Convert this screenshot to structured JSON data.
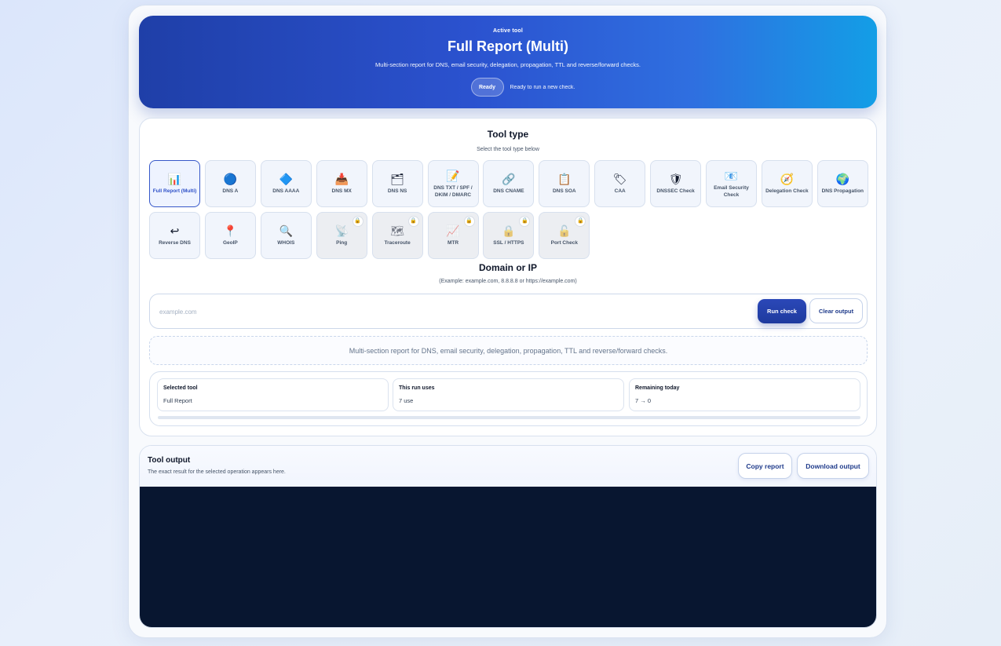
{
  "hero": {
    "kicker": "Active tool",
    "title": "Full Report (Multi)",
    "description": "Multi-section report for DNS, email security, delegation, propagation, TTL and reverse/forward checks.",
    "badge": "Ready",
    "status_text": "Ready to run a new check."
  },
  "tool_type": {
    "title": "Tool type",
    "subtitle": "Select the tool type below",
    "tools": [
      {
        "label": "Full Report (Multi)",
        "icon": "📊",
        "active": true,
        "locked": false
      },
      {
        "label": "DNS A",
        "icon": "🔵",
        "active": false,
        "locked": false
      },
      {
        "label": "DNS AAAA",
        "icon": "🔷",
        "active": false,
        "locked": false
      },
      {
        "label": "DNS MX",
        "icon": "📥",
        "active": false,
        "locked": false
      },
      {
        "label": "DNS NS",
        "icon": "🗂",
        "active": false,
        "locked": false
      },
      {
        "label": "DNS TXT / SPF / DKIM / DMARC",
        "icon": "📝",
        "active": false,
        "locked": false
      },
      {
        "label": "DNS CNAME",
        "icon": "🔗",
        "active": false,
        "locked": false
      },
      {
        "label": "DNS SOA",
        "icon": "📋",
        "active": false,
        "locked": false
      },
      {
        "label": "CAA",
        "icon": "🏷",
        "active": false,
        "locked": false
      },
      {
        "label": "DNSSEC Check",
        "icon": "🛡",
        "active": false,
        "locked": false
      },
      {
        "label": "Email Security Check",
        "icon": "📧",
        "active": false,
        "locked": false
      },
      {
        "label": "Delegation Check",
        "icon": "🧭",
        "active": false,
        "locked": false
      },
      {
        "label": "DNS Propagation",
        "icon": "🌍",
        "active": false,
        "locked": false
      },
      {
        "label": "Reverse DNS",
        "icon": "↩",
        "active": false,
        "locked": false
      },
      {
        "label": "GeoIP",
        "icon": "📍",
        "active": false,
        "locked": false
      },
      {
        "label": "WHOIS",
        "icon": "🔍",
        "active": false,
        "locked": false
      },
      {
        "label": "Ping",
        "icon": "📡",
        "active": false,
        "locked": true
      },
      {
        "label": "Traceroute",
        "icon": "🗺",
        "active": false,
        "locked": true
      },
      {
        "label": "MTR",
        "icon": "📈",
        "active": false,
        "locked": true
      },
      {
        "label": "SSL / HTTPS",
        "icon": "🔒",
        "active": false,
        "locked": true
      },
      {
        "label": "Port Check",
        "icon": "🔓",
        "active": false,
        "locked": true
      }
    ],
    "lock_icon": "🔒"
  },
  "domain": {
    "title": "Domain or IP",
    "subtitle": "(Example: example.com, 8.8.8.8 or https://example.com)",
    "placeholder": "example.com",
    "value": "",
    "run_label": "Run check",
    "clear_label": "Clear output"
  },
  "description_box": "Multi-section report for DNS, email security, delegation, propagation, TTL and reverse/forward checks.",
  "summary": {
    "selected_label": "Selected tool",
    "selected_value": "Full Report",
    "uses_label": "This run uses",
    "uses_value": "7 use",
    "remaining_label": "Remaining today",
    "remaining_value": "7 → 0",
    "usage_fraction": 0
  },
  "output": {
    "title": "Tool output",
    "subtitle": "The exact result for the selected operation appears here.",
    "copy_label": "Copy report",
    "download_label": "Download output",
    "content": ""
  },
  "colors": {
    "accent": "#2b48b8",
    "hero_start": "#1f3fa8",
    "hero_end": "#139ee6",
    "terminal_bg": "#081630"
  }
}
